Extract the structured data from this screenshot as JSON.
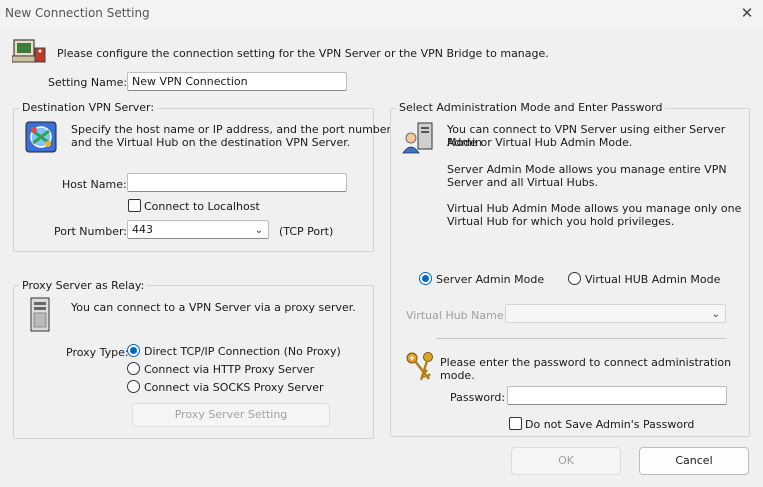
{
  "window": {
    "title": "New Connection Setting",
    "close_glyph": "✕"
  },
  "intro": {
    "text": "Please configure the connection setting for the VPN Server or the VPN Bridge to manage."
  },
  "setting_name": {
    "label": "Setting Name:",
    "value": "New VPN Connection"
  },
  "destination": {
    "legend": "Destination VPN Server:",
    "desc_line1": "Specify the host name or IP address, and the port number",
    "desc_line2": "and the Virtual Hub on the destination VPN Server.",
    "host_label": "Host Name:",
    "host_value": "",
    "localhost_label": "Connect to Localhost",
    "port_label": "Port Number:",
    "port_value": "443",
    "port_suffix": "(TCP Port)"
  },
  "proxy": {
    "legend": "Proxy Server as Relay:",
    "desc": "You can connect to a VPN Server via a proxy server.",
    "type_label": "Proxy Type:",
    "options": [
      "Direct TCP/IP Connection (No Proxy)",
      "Connect via HTTP Proxy Server",
      "Connect via SOCKS Proxy Server"
    ],
    "selected": "Direct TCP/IP Connection (No Proxy)",
    "setting_button": "Proxy Server Setting"
  },
  "admin": {
    "legend": "Select Administration Mode and Enter Password",
    "p1_line1": "You can connect to VPN Server using either Server Admin",
    "p1_line2": "Mode or Virtual Hub Admin Mode.",
    "p2_line1": "Server Admin Mode allows you manage entire VPN",
    "p2_line2": "Server and all Virtual Hubs.",
    "p3_line1": "Virtual Hub Admin Mode allows you manage only one",
    "p3_line2": "Virtual Hub for which you hold privileges.",
    "mode_server": "Server Admin Mode",
    "mode_hub": "Virtual HUB Admin Mode",
    "selected_mode": "Server Admin Mode",
    "hub_name_label": "Virtual Hub Name:",
    "hub_name_value": "",
    "password_prompt": "Please enter the password to connect administration mode.",
    "password_label": "Password:",
    "password_value": "",
    "no_save_label": "Do not Save Admin's Password"
  },
  "footer": {
    "ok": "OK",
    "cancel": "Cancel"
  },
  "icons": [
    "computer-icon",
    "network-globe-icon",
    "server-tower-icon",
    "users-server-icon",
    "keys-icon"
  ],
  "colors": {
    "accent": "#0067c0",
    "background": "#f0f0f0"
  }
}
